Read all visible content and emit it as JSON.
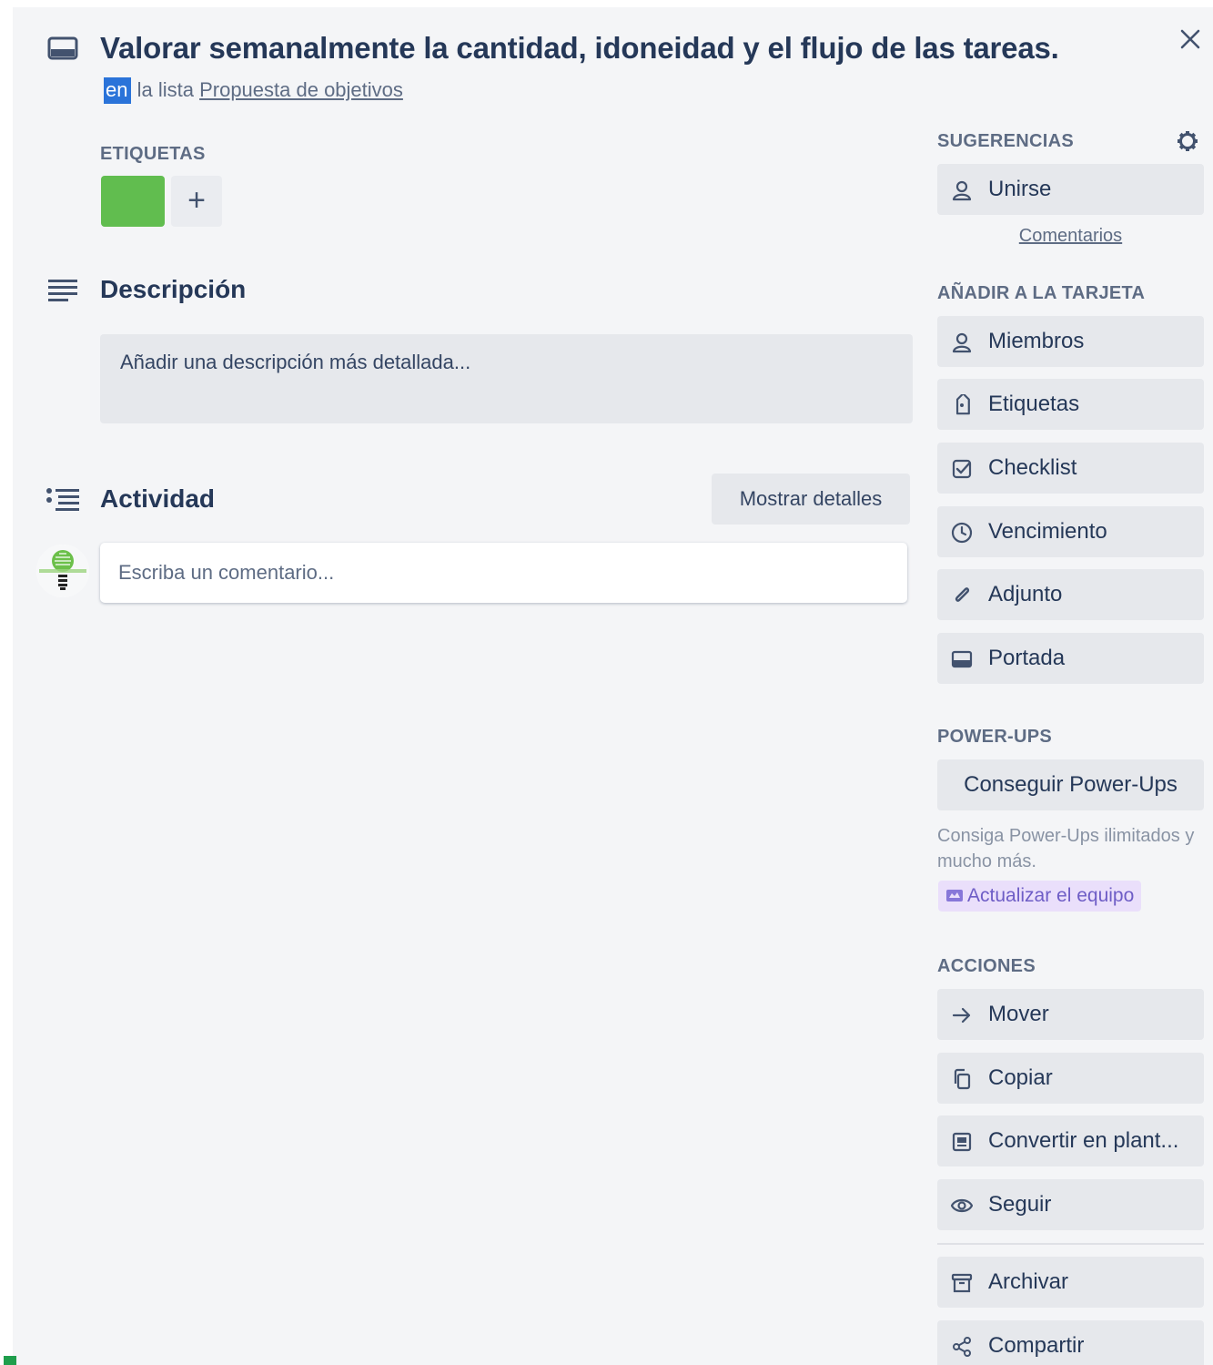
{
  "card": {
    "title": "Valorar semanalmente la cantidad, idoneidad y el flujo de las tareas.",
    "subtitle_prefix": "en",
    "subtitle_middle": " la lista ",
    "list_name": "Propuesta de objetivos",
    "label_color": "#61bd4f"
  },
  "labels_section": {
    "heading": "ETIQUETAS",
    "add_symbol": "+"
  },
  "description": {
    "heading": "Descripción",
    "placeholder": "Añadir una descripción más detallada..."
  },
  "activity": {
    "heading": "Actividad",
    "show_details": "Mostrar detalles",
    "comment_placeholder": "Escriba un comentario..."
  },
  "sidebar": {
    "suggestions_heading": "SUGERENCIAS",
    "join": {
      "label": "Unirse",
      "icon": "user-icon"
    },
    "comments_link": "Comentarios",
    "add_heading": "AÑADIR A LA TARJETA",
    "add_items": [
      {
        "label": "Miembros",
        "icon": "user-icon"
      },
      {
        "label": "Etiquetas",
        "icon": "tag-icon"
      },
      {
        "label": "Checklist",
        "icon": "checklist-icon"
      },
      {
        "label": "Vencimiento",
        "icon": "clock-icon"
      },
      {
        "label": "Adjunto",
        "icon": "paperclip-icon"
      },
      {
        "label": "Portada",
        "icon": "cover-icon"
      }
    ],
    "powerups_heading": "POWER-UPS",
    "get_powerups": "Conseguir Power-Ups",
    "powerups_note": "Consiga Power-Ups ilimitados y mucho más.",
    "upgrade_label": "Actualizar el equipo",
    "actions_heading": "ACCIONES",
    "actions": [
      {
        "label": "Mover",
        "icon": "arrow-right-icon"
      },
      {
        "label": "Copiar",
        "icon": "copy-icon"
      },
      {
        "label": "Convertir en plant...",
        "icon": "template-icon"
      },
      {
        "label": "Seguir",
        "icon": "eye-icon"
      },
      {
        "label": "Archivar",
        "icon": "archive-icon"
      },
      {
        "label": "Compartir",
        "icon": "share-icon"
      }
    ]
  },
  "colors": {
    "background": "#f4f5f7",
    "button": "#e6e8ec",
    "text": "#172b4d",
    "label_green": "#61bd4f",
    "selection": "#2a73d9",
    "upgrade_bg": "#eadffb"
  }
}
